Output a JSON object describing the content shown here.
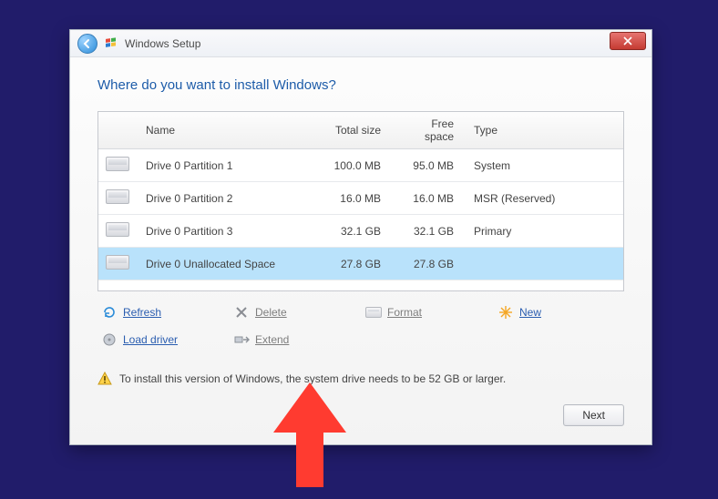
{
  "window": {
    "title": "Windows Setup"
  },
  "heading": "Where do you want to install Windows?",
  "columns": {
    "name": "Name",
    "total": "Total size",
    "free": "Free space",
    "type": "Type"
  },
  "rows": [
    {
      "name": "Drive 0 Partition 1",
      "total": "100.0 MB",
      "free": "95.0 MB",
      "type": "System",
      "selected": false
    },
    {
      "name": "Drive 0 Partition 2",
      "total": "16.0 MB",
      "free": "16.0 MB",
      "type": "MSR (Reserved)",
      "selected": false
    },
    {
      "name": "Drive 0 Partition 3",
      "total": "32.1 GB",
      "free": "32.1 GB",
      "type": "Primary",
      "selected": false
    },
    {
      "name": "Drive 0 Unallocated Space",
      "total": "27.8 GB",
      "free": "27.8 GB",
      "type": "",
      "selected": true
    }
  ],
  "actions": {
    "refresh": "Refresh",
    "delete": "Delete",
    "format": "Format",
    "new": "New",
    "load_driver": "Load driver",
    "extend": "Extend"
  },
  "warning": "To install this version of Windows, the system drive needs to be 52 GB or larger.",
  "buttons": {
    "next": "Next"
  }
}
